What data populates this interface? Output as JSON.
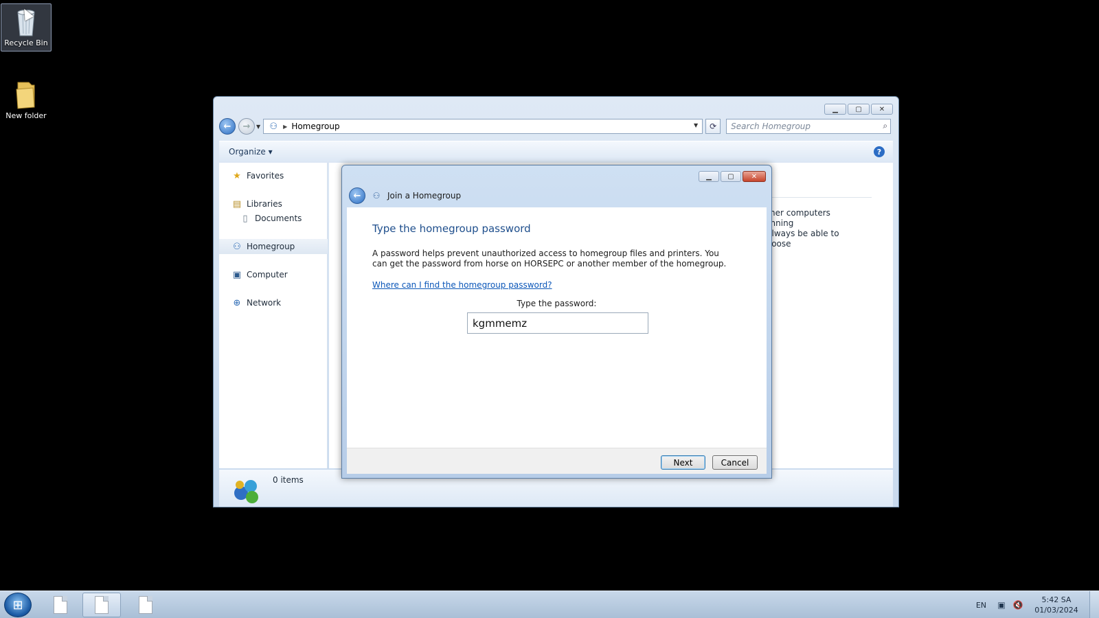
{
  "desktop": {
    "icons": [
      {
        "label": "Recycle Bin",
        "icon": "recycle-bin-icon"
      },
      {
        "label": "New folder",
        "icon": "folder-icon"
      }
    ]
  },
  "explorer": {
    "address": {
      "crumb": "Homegroup"
    },
    "search": {
      "placeholder": "Search Homegroup"
    },
    "toolbar": {
      "organize_label": "Organize"
    },
    "nav": {
      "favorites": "Favorites",
      "libraries": "Libraries",
      "documents": "Documents",
      "homegroup": "Homegroup",
      "computer": "Computer",
      "network": "Network"
    },
    "content": {
      "line1": "other computers running",
      "line2": "l always be able to choose"
    },
    "status": {
      "items": "0 items"
    }
  },
  "dialog": {
    "title": "Join a Homegroup",
    "heading": "Type the homegroup password",
    "description": "A password helps prevent unauthorized access to homegroup files and printers. You can get the password from horse on HORSEPC or another member of the homegroup.",
    "help_link": "Where can I find the homegroup password?",
    "password_label": "Type the password:",
    "password_value": "kgmmemz",
    "next_label": "Next",
    "cancel_label": "Cancel"
  },
  "taskbar": {
    "language": "EN",
    "time": "5:42 SA",
    "date": "01/03/2024"
  },
  "colors": {
    "heading": "#1e4e8c",
    "link": "#0a56b8",
    "close_button": "#c7452c"
  }
}
